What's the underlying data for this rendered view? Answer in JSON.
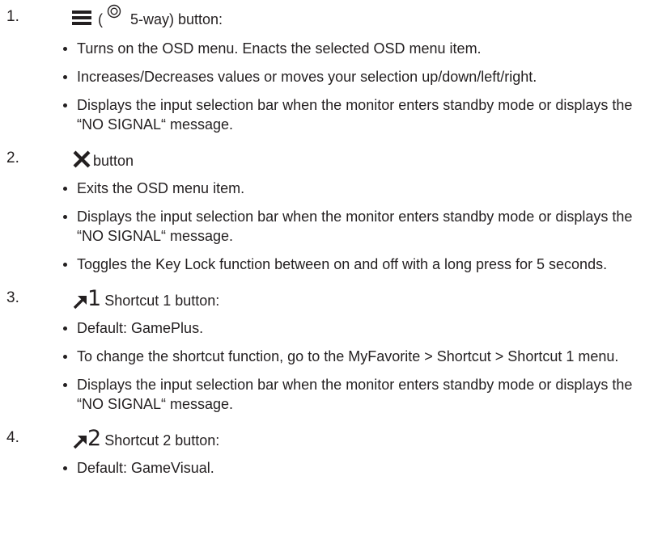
{
  "items": [
    {
      "number": "1.",
      "icon": "menu-icon",
      "paren_open": "(",
      "secondary_icon": "five-way-icon",
      "title": "5-way) button:",
      "bullets": [
        "Turns on the OSD menu. Enacts the selected OSD menu item.",
        "Increases/Decreases values or moves your selection up/down/left/right.",
        "Displays the input selection bar when the monitor  enters standby mode or displays the “NO SIGNAL“ message."
      ]
    },
    {
      "number": "2.",
      "icon": "close-icon",
      "title": "button",
      "bullets": [
        "Exits the OSD menu item.",
        "Displays the input selection bar when the monitor  enters standby mode or displays the “NO SIGNAL“ message.",
        "Toggles the Key Lock function between on and off with a long press for 5 seconds."
      ]
    },
    {
      "number": "3.",
      "icon": "shortcut-arrow-icon",
      "icon_label": "1",
      "title": "Shortcut 1 button:",
      "bullets": [
        "Default: GamePlus.",
        "To change the shortcut function, go to the MyFavorite > Shortcut > Shortcut 1 menu.",
        "Displays the input selection bar when the monitor  enters standby mode or displays the “NO SIGNAL“ message."
      ]
    },
    {
      "number": "4.",
      "icon": "shortcut-arrow-icon",
      "icon_label": "2",
      "title": "Shortcut 2 button:",
      "bullets": [
        "Default: GameVisual."
      ]
    }
  ],
  "colors": {
    "text": "#231f20",
    "background": "#ffffff"
  }
}
